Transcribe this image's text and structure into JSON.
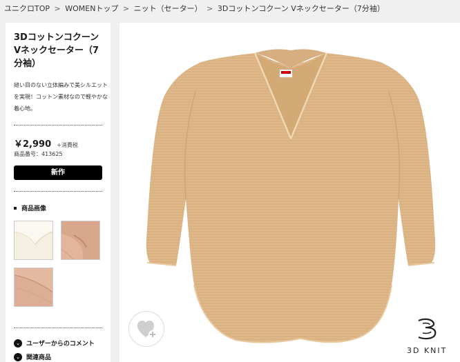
{
  "breadcrumb": {
    "items": [
      "ユニクロTOP",
      "WOMENトップ",
      "ニット（セーター）",
      "3Dコットンコクーン Vネックセーター（7分袖）"
    ],
    "separator": ">"
  },
  "product": {
    "title": "3Dコットンコクーン Vネックセーター（7分袖）",
    "description": "縫い目のない立体編みで美シルエットを実現！コットン素材なので軽やかな着心地。",
    "price": "￥2,990",
    "tax_note": "+消費税",
    "code": "商品番号：413625",
    "new_label": "新作"
  },
  "images_section": {
    "title": "商品画像",
    "thumbnails": [
      {
        "name": "neckline-closeup",
        "color": "#f5efe2"
      },
      {
        "name": "sleeve-closeup",
        "color": "#e3b59d"
      },
      {
        "name": "fabric-closeup",
        "color": "#e4b9a1"
      }
    ]
  },
  "accordions": [
    {
      "label": "ユーザーからのコメント",
      "icon": "chevron-down-icon"
    },
    {
      "label": "関連商品",
      "icon": "chevron-down-icon"
    }
  ],
  "main_image": {
    "subject": "v-neck-sweater",
    "sweater_color": "#e0b98c",
    "knit_line_color": "#c99b6a"
  },
  "favorite_button": {
    "icon": "heart-plus-icon"
  },
  "badge": {
    "text": "3D KNIT",
    "icon": "3d-knit-logo-icon"
  }
}
